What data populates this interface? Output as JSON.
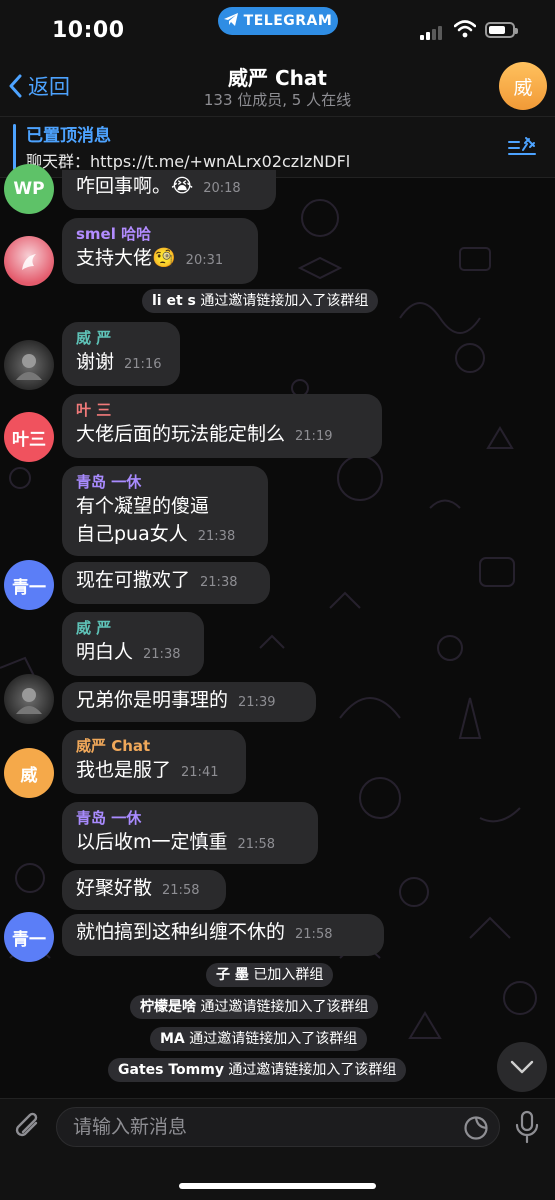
{
  "status_bar": {
    "time": "10:00",
    "app_pill": "TELEGRAM"
  },
  "header": {
    "back_label": "返回",
    "title": "威严 Chat",
    "subtitle": "133 位成员, 5 人在线",
    "avatar_text": "威"
  },
  "pinned": {
    "title": "已置顶消息",
    "text": "聊天群：https://t.me/+wnALrx02czIzNDFl"
  },
  "messages": [
    {
      "avatar_text": "WP",
      "avatar_color": "#5ec268",
      "sender": "",
      "text": "咋回事啊。😭",
      "time": "20:18"
    },
    {
      "avatar_text": "",
      "avatar_color": "#e45b6c",
      "sender": "smel 哈哈",
      "sender_color": "#b28cff",
      "text": "支持大佬🧐",
      "time": "20:31"
    },
    {
      "service": true,
      "who": "li et s",
      "text": " 通过邀请链接加入了该群组"
    },
    {
      "avatar_text": "",
      "avatar_color": "#3a3a3a",
      "sender": "威 严",
      "sender_color": "#5ec2b7",
      "text": "谢谢",
      "time": "21:16"
    },
    {
      "avatar_text": "叶三",
      "avatar_color": "#f0525e",
      "sender": "叶 三",
      "sender_color": "#f17a7a",
      "text": "大佬后面的玩法能定制么",
      "time": "21:19"
    },
    {
      "avatar_text": "",
      "avatar_color": "#5b7ef7",
      "sender": "青岛 一休",
      "sender_color": "#a98bff",
      "text_lines": [
        "有个凝望的傻逼",
        "自己pua女人"
      ],
      "time": "21:38"
    },
    {
      "avatar_text": "青一",
      "avatar_color": "#5b7ef7",
      "sender": "",
      "text": "现在可撒欢了",
      "time": "21:38"
    },
    {
      "avatar_text": "",
      "avatar_color": "#3a3a3a",
      "sender": "威 严",
      "sender_color": "#5ec2b7",
      "text": "明白人",
      "time": "21:38"
    },
    {
      "avatar_text": "",
      "avatar_color": "#3a3a3a",
      "sender": "",
      "text": "兄弟你是明事理的",
      "time": "21:39"
    },
    {
      "avatar_text": "威",
      "avatar_color": "#f5a94a",
      "sender": "威严 Chat",
      "sender_color": "#f0a85a",
      "text": "我也是服了",
      "time": "21:41"
    },
    {
      "avatar_text": "",
      "avatar_color": "#5b7ef7",
      "sender": "青岛 一休",
      "sender_color": "#a98bff",
      "text": "以后收m一定慎重",
      "time": "21:58"
    },
    {
      "avatar_text": "",
      "avatar_color": "#5b7ef7",
      "sender": "",
      "text": "好聚好散",
      "time": "21:58"
    },
    {
      "avatar_text": "青一",
      "avatar_color": "#5b7ef7",
      "sender": "",
      "text": "就怕搞到这种纠缠不休的",
      "time": "21:58"
    },
    {
      "service": true,
      "who": "子 墨",
      "text": " 已加入群组"
    },
    {
      "service": true,
      "who": "柠檬是啥",
      "text": " 通过邀请链接加入了该群组"
    },
    {
      "service": true,
      "who": "MA",
      "text": " 通过邀请链接加入了该群组"
    },
    {
      "service": true,
      "who": "Gates Tommy",
      "text": " 通过邀请链接加入了该群组"
    }
  ],
  "input": {
    "placeholder": "请输入新消息"
  },
  "icons": [
    "telegram-plane-icon",
    "signal-icon",
    "wifi-icon",
    "battery-icon",
    "back-chevron-icon",
    "pin-list-icon",
    "attach-icon",
    "sticker-icon",
    "mic-icon",
    "chevron-down-icon"
  ]
}
